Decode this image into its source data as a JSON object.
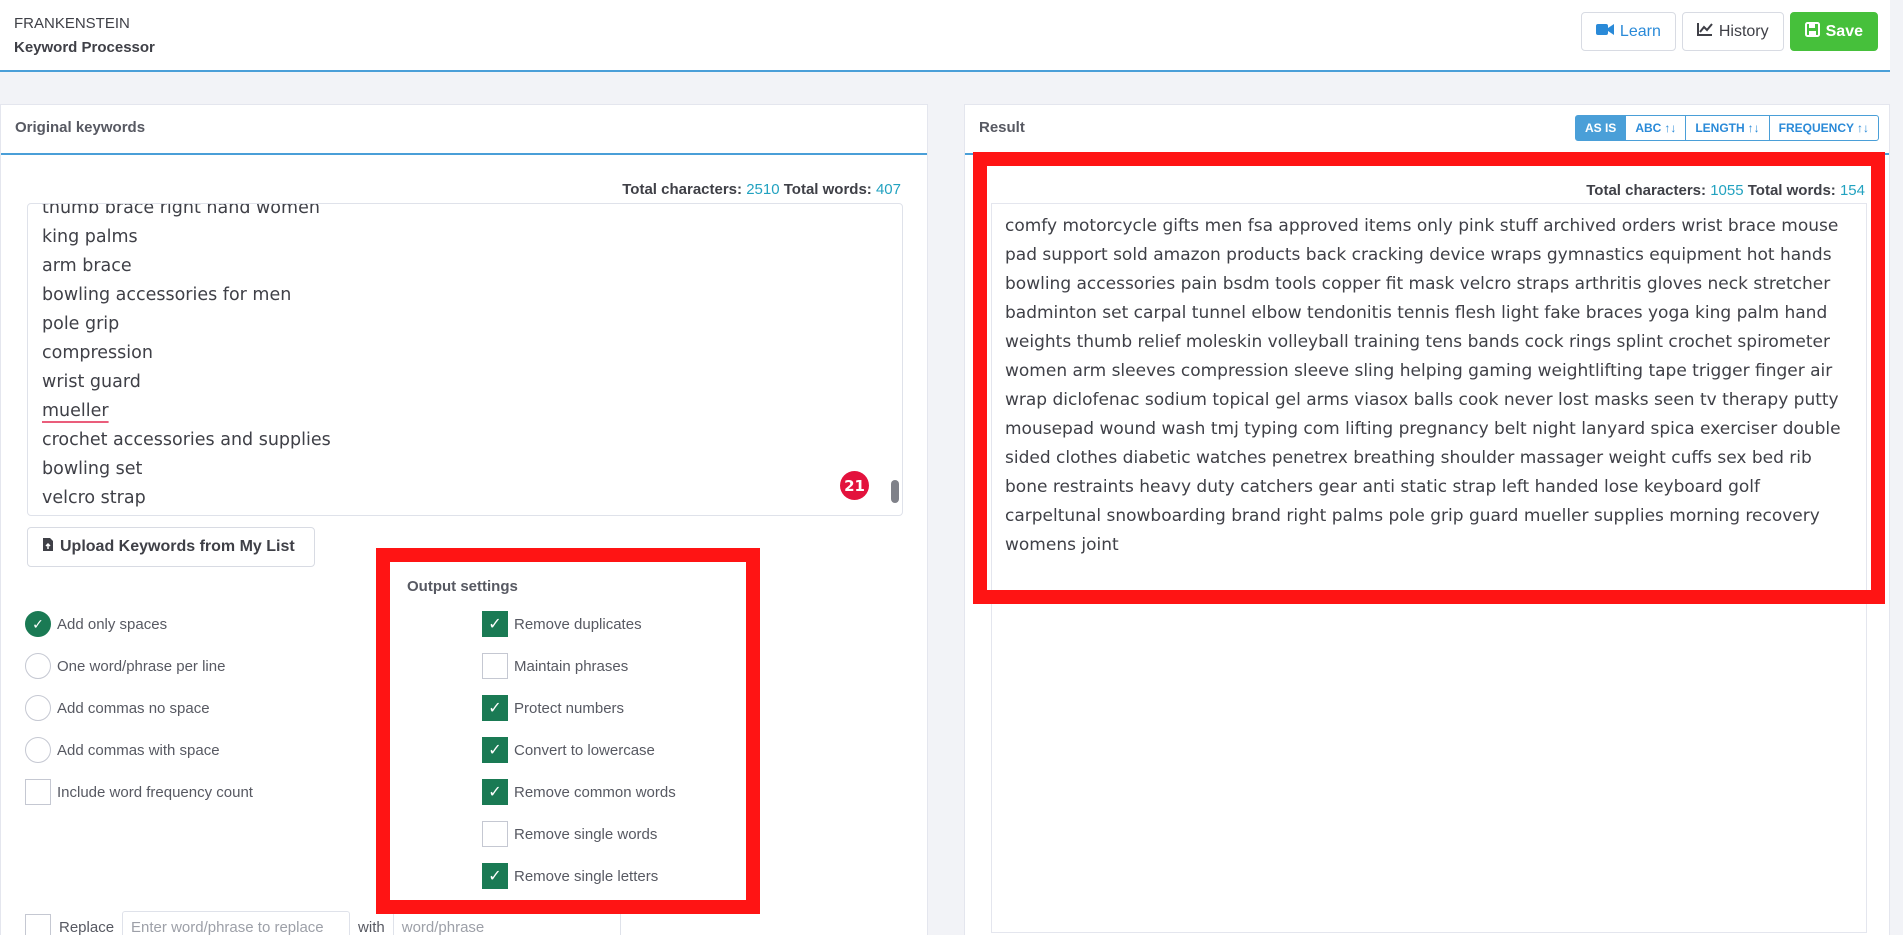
{
  "header": {
    "brand_title": "FRANKENSTEIN",
    "brand_subtitle": "Keyword Processor",
    "buttons": {
      "learn": "Learn",
      "history": "History",
      "save": "Save"
    }
  },
  "left": {
    "title": "Original keywords",
    "stats": {
      "chars_label": "Total characters:",
      "chars_value": "2510",
      "words_label": "Total words:",
      "words_value": "407"
    },
    "keywords": [
      "thumb brace right hand women",
      "king palms",
      "arm brace",
      "bowling accessories for men",
      "pole grip",
      "compression",
      "wrist guard",
      "mueller",
      "crochet accessories and supplies",
      "bowling set",
      "velcro strap"
    ],
    "badge_count": "21",
    "upload_label": "Upload Keywords from My List",
    "format_options": [
      {
        "label": "Add only spaces",
        "selected": true
      },
      {
        "label": "One word/phrase per line",
        "selected": false
      },
      {
        "label": "Add commas no space",
        "selected": false
      },
      {
        "label": "Add commas with space",
        "selected": false
      }
    ],
    "frequency_option": {
      "label": "Include word frequency count",
      "checked": false
    },
    "output_settings": {
      "title": "Output settings",
      "items": [
        {
          "label": "Remove duplicates",
          "checked": true
        },
        {
          "label": "Maintain phrases",
          "checked": false
        },
        {
          "label": "Protect numbers",
          "checked": true
        },
        {
          "label": "Convert to lowercase",
          "checked": true
        },
        {
          "label": "Remove common words",
          "checked": true
        },
        {
          "label": "Remove single words",
          "checked": false
        },
        {
          "label": "Remove single letters",
          "checked": true
        }
      ]
    },
    "replace": {
      "label": "Replace",
      "find_placeholder": "Enter word/phrase to replace",
      "with_label": "with",
      "with_placeholder": "word/phrase"
    }
  },
  "right": {
    "title": "Result",
    "sort_tabs": [
      {
        "label": "AS IS",
        "active": true
      },
      {
        "label": "ABC",
        "active": false
      },
      {
        "label": "LENGTH",
        "active": false
      },
      {
        "label": "FREQUENCY",
        "active": false
      }
    ],
    "stats": {
      "chars_label": "Total characters:",
      "chars_value": "1055",
      "words_label": "Total words:",
      "words_value": "154"
    },
    "result_text": "comfy motorcycle gifts men fsa approved items only pink stuff archived orders wrist brace mouse pad support sold amazon products back cracking device wraps gymnastics equipment hot hands bowling accessories pain bsdm tools copper fit mask velcro straps arthritis gloves neck stretcher badminton set carpal tunnel elbow tendonitis tennis flesh light fake braces yoga king palm hand weights thumb relief moleskin volleyball training tens bands cock rings splint crochet spirometer women arm sleeves compression sleeve sling helping gaming weightlifting tape trigger finger air wrap diclofenac sodium topical gel arms viasox balls cook never lost masks seen tv therapy putty mousepad wound wash tmj typing com lifting pregnancy belt night lanyard spica exerciser double sided clothes diabetic watches penetrex breathing shoulder massager weight cuffs sex bed rib bone restraints heavy duty catchers gear anti static strap left handed lose keyboard golf carpeltunal snowboarding brand right palms pole grip guard mueller supplies morning recovery womens joint"
  },
  "colors": {
    "accent": "#4a9fd8",
    "check_green": "#1a7a54",
    "save_green": "#46c03b",
    "highlight_red": "#ff1414",
    "badge_red": "#e3123d"
  }
}
